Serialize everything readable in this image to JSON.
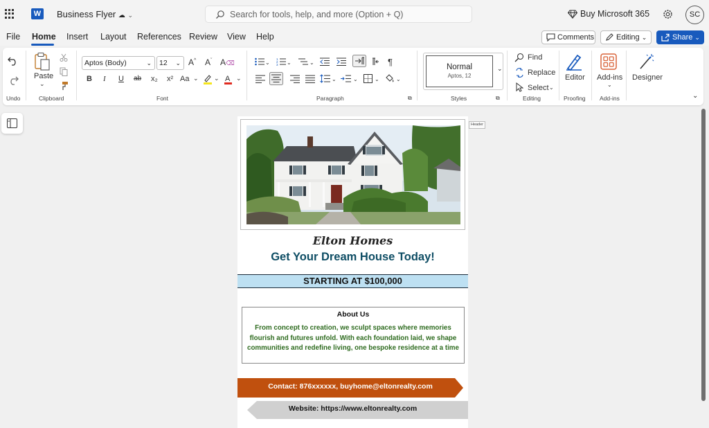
{
  "titlebar": {
    "app_icon": "word-icon",
    "app_letter": "W",
    "doc_title": "Business Flyer",
    "search_placeholder": "Search for tools, help, and more (Option + Q)",
    "buy_label": "Buy Microsoft 365",
    "user_initials": "SC"
  },
  "menu": {
    "items": [
      "File",
      "Home",
      "Insert",
      "Layout",
      "References",
      "Review",
      "View",
      "Help"
    ],
    "active": "Home",
    "comments_label": "Comments",
    "editing_label": "Editing",
    "share_label": "Share"
  },
  "ribbon": {
    "undo_label": "Undo",
    "clipboard_label": "Clipboard",
    "paste_label": "Paste",
    "font_label": "Font",
    "font_name": "Aptos (Body)",
    "font_size": "12",
    "font_tools": [
      "A^",
      "A˅",
      "A✎"
    ],
    "bold": "B",
    "italic": "I",
    "underline": "U",
    "strike": "ab",
    "subscript": "x₂",
    "superscript": "x²",
    "case": "Aa",
    "paragraph_label": "Paragraph",
    "styles_label": "Styles",
    "style_name": "Normal",
    "style_sub": "Aptos, 12",
    "editing_label": "Editing",
    "find_label": "Find",
    "replace_label": "Replace",
    "select_label": "Select",
    "proofing_label": "Proofing",
    "editor_label": "Editor",
    "addins_group_label": "Add-ins",
    "addins_label": "Add-ins",
    "designer_label": "Designer"
  },
  "document": {
    "header_tag": "Header",
    "company": "Elton Homes",
    "headline": "Get Your Dream House Today!",
    "price_banner": "STARTING AT $100,000",
    "about_title": "About Us",
    "about_lines": [
      "From concept to creation, we sculpt spaces where memories",
      "flourish and futures unfold. With each foundation laid, we shape",
      "communities and redefine living, one bespoke residence at a time"
    ],
    "contact": "Contact: 876xxxxxx, buyhome@eltonrealty.com",
    "website": "Website: https://www.eltonrealty.com"
  },
  "colors": {
    "brand": "#185abd",
    "headline": "#0e4d64",
    "about_text": "#2e6b1f",
    "price_bg": "#bde0f2",
    "contact_bg": "#c0500e",
    "website_bg": "#d0d0d0"
  }
}
